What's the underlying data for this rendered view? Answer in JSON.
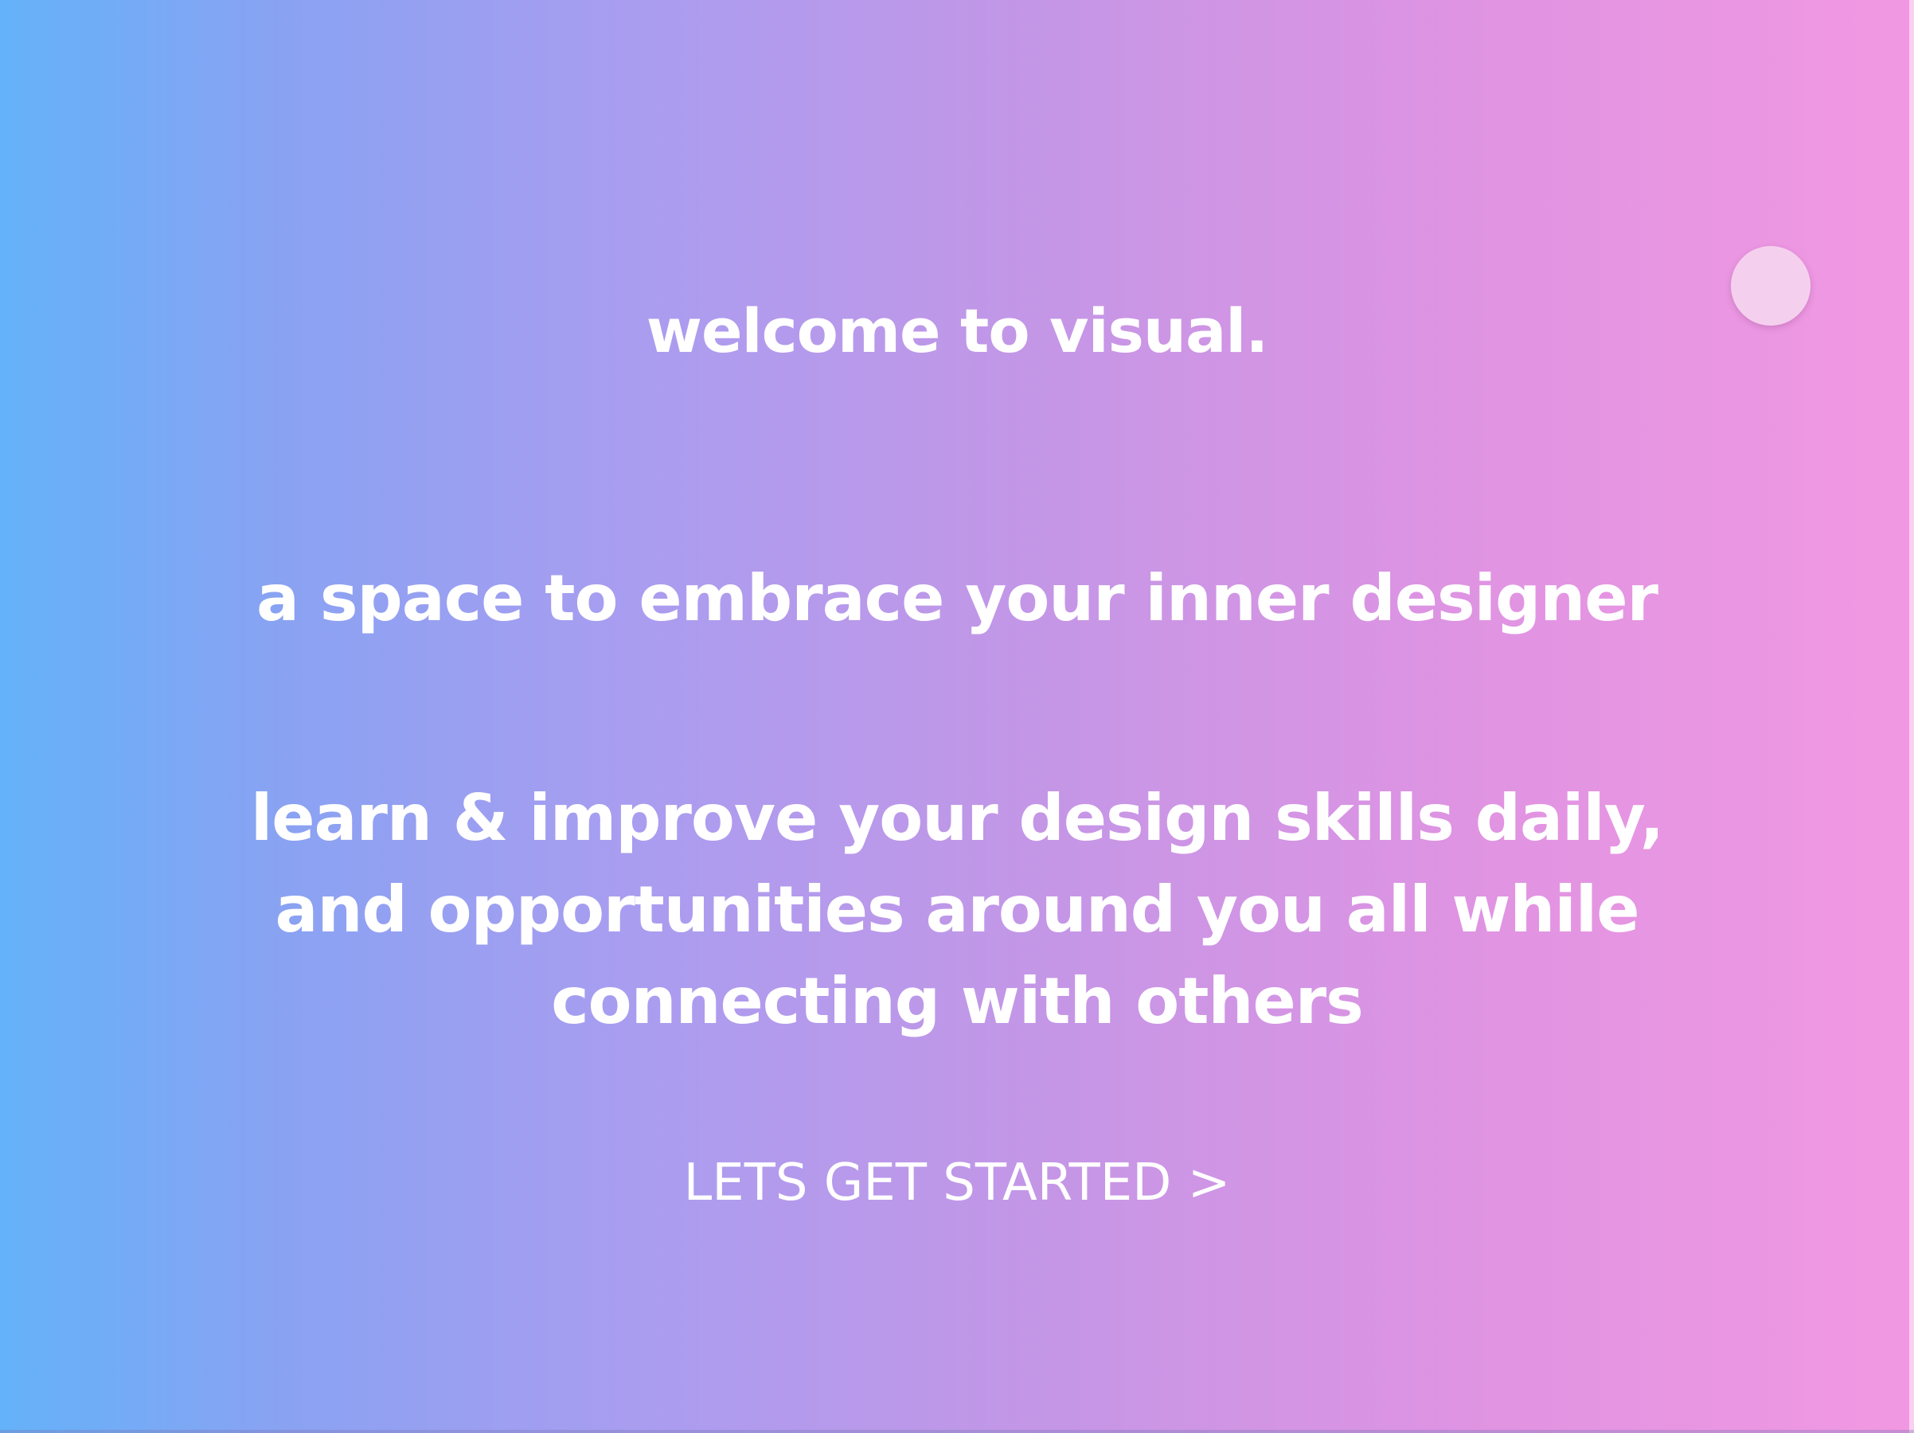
{
  "welcome": {
    "title": "welcome to visual."
  },
  "tagline": "a space to embrace your inner designer",
  "description": {
    "lines": [
      "learn & improve your design skills daily,",
      "and opportunities around you all while",
      "connecting with others"
    ]
  },
  "cta": {
    "label": "LETS GET STARTED",
    "arrow": ">"
  },
  "colors": {
    "gradient_start": "#64b2f9",
    "gradient_mid": "#a99df0",
    "gradient_end": "#f298e2",
    "text": "#ffffff",
    "toggle": "#f5d0ee"
  },
  "icons": {
    "toggle": "circle-toggle-icon"
  }
}
